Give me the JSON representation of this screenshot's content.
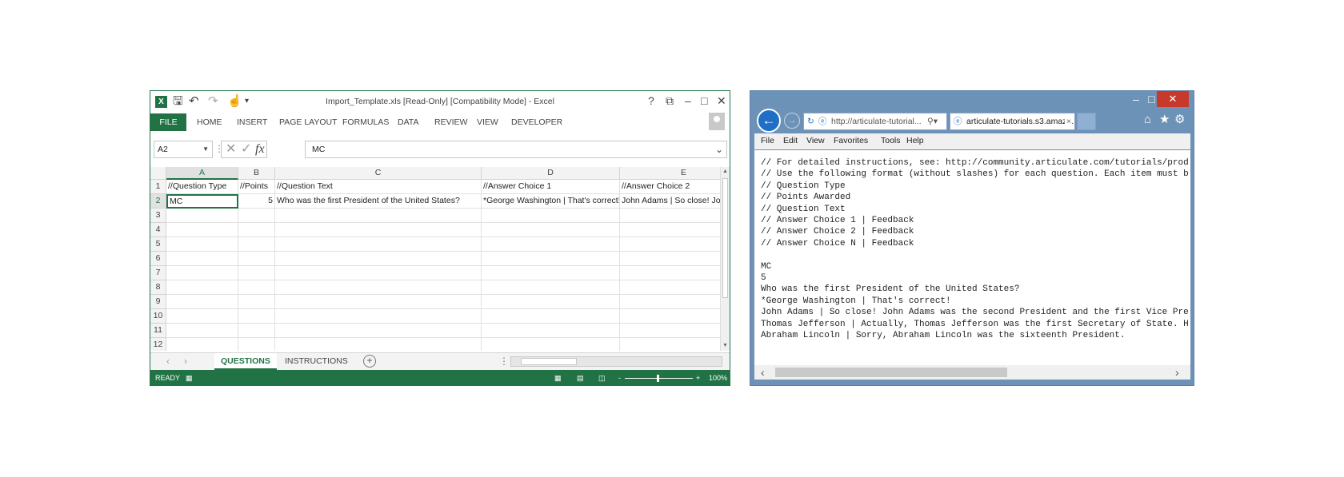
{
  "excel": {
    "title": "Import_Template.xls  [Read-Only]  [Compatibility Mode] - Excel",
    "logo": "X",
    "title_controls": [
      "?",
      "⧉",
      "–",
      "□",
      "✕"
    ],
    "ribbon_file": "FILE",
    "ribbon_tabs": [
      "HOME",
      "INSERT",
      "PAGE LAYOUT",
      "FORMULAS",
      "DATA",
      "REVIEW",
      "VIEW",
      "DEVELOPER"
    ],
    "name_box": "A2",
    "formula_icons": [
      "✕",
      "✓",
      "fx"
    ],
    "formula_value": "MC",
    "columns": [
      "A",
      "B",
      "C",
      "D",
      "E"
    ],
    "rows": [
      "1",
      "2",
      "3",
      "4",
      "5",
      "6",
      "7",
      "8",
      "9",
      "10",
      "11",
      "12"
    ],
    "cells": [
      [
        "//Question Type",
        "//Points",
        "//Question Text",
        "//Answer Choice 1",
        "//Answer Choice 2"
      ],
      [
        "MC",
        "5",
        "Who was the first President of the United States?",
        "*George Washington | That's correct!",
        "John Adams | So close! John Adams was the second President"
      ]
    ],
    "sheets": [
      "QUESTIONS",
      "INSTRUCTIONS"
    ],
    "add_sheet": "+",
    "status": "READY",
    "zoom": "100%",
    "zoom_minus": "-",
    "zoom_plus": "+"
  },
  "ie": {
    "min": "–",
    "max": "□",
    "close": "✕",
    "back": "←",
    "forward": "→",
    "address": "http://articulate-tutorial...",
    "tab_title": "articulate-tutorials.s3.amaz...",
    "tab_close": "×",
    "tools": [
      "⌂",
      "★",
      "⚙"
    ],
    "menu": [
      "File",
      "Edit",
      "View",
      "Favorites",
      "Tools",
      "Help"
    ],
    "lines": [
      "// For detailed instructions, see: http://community.articulate.com/tutorials/prod",
      "// Use the following format (without slashes) for each question. Each item must b",
      "// Question Type",
      "// Points Awarded",
      "// Question Text",
      "// Answer Choice 1 | Feedback",
      "// Answer Choice 2 | Feedback",
      "// Answer Choice N | Feedback",
      "",
      "MC",
      "5",
      "Who was the first President of the United States?",
      "*George Washington | That's correct!",
      "John Adams | So close! John Adams was the second President and the first Vice Pre",
      "Thomas Jefferson | Actually, Thomas Jefferson was the first Secretary of State. H",
      "Abraham Lincoln | Sorry, Abraham Lincoln was the sixteenth President."
    ]
  }
}
